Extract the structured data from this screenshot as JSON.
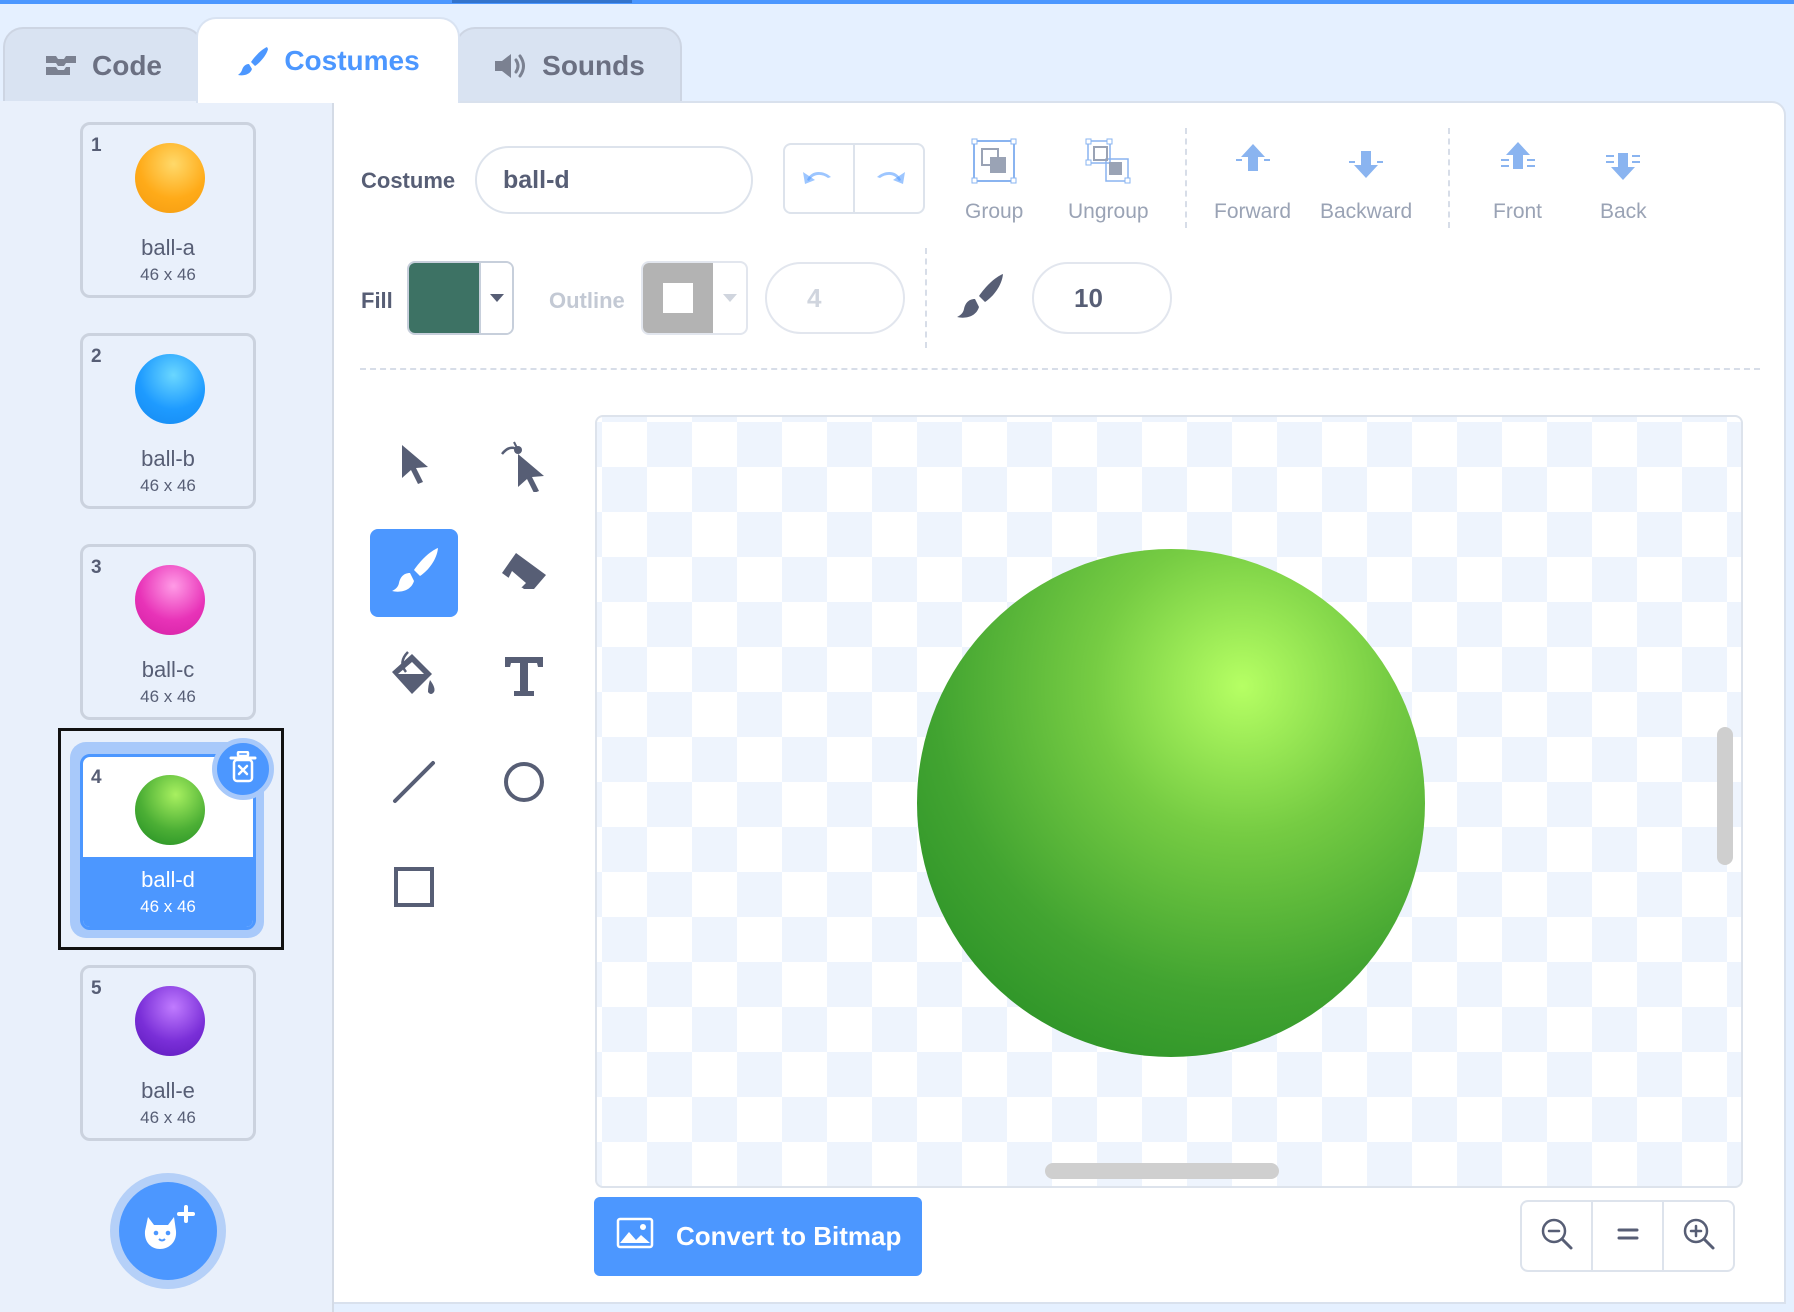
{
  "tabs": [
    {
      "label": "Code",
      "icon": "code-blocks-icon"
    },
    {
      "label": "Costumes",
      "icon": "paintbrush-icon",
      "active": true
    },
    {
      "label": "Sounds",
      "icon": "speaker-icon"
    }
  ],
  "costumes": [
    {
      "number": "1",
      "name": "ball-a",
      "size": "46 x 46",
      "color": "#ffab19"
    },
    {
      "number": "2",
      "name": "ball-b",
      "size": "46 x 46",
      "color": "#1e9bff"
    },
    {
      "number": "3",
      "name": "ball-c",
      "size": "46 x 46",
      "color": "#e833b8"
    },
    {
      "number": "4",
      "name": "ball-d",
      "size": "46 x 46",
      "color": "#3da534",
      "selected": true
    },
    {
      "number": "5",
      "name": "ball-e",
      "size": "46 x 46",
      "color": "#6a22c9"
    }
  ],
  "toolbar": {
    "costume_label": "Costume",
    "costume_name": "ball-d",
    "group_label": "Group",
    "ungroup_label": "Ungroup",
    "forward_label": "Forward",
    "backward_label": "Backward",
    "front_label": "Front",
    "back_label": "Back"
  },
  "properties": {
    "fill_label": "Fill",
    "fill_color": "#3d7264",
    "outline_label": "Outline",
    "outline_width": "4",
    "brush_size": "10"
  },
  "tools": [
    "select",
    "reshape",
    "brush",
    "eraser",
    "fill",
    "text",
    "line",
    "circle",
    "rectangle"
  ],
  "active_tool": "brush",
  "canvas": {
    "shape_color": "#3da534"
  },
  "convert_label": "Convert to Bitmap",
  "zoom": {
    "out": "zoom-out",
    "reset": "=",
    "in": "zoom-in"
  },
  "colors": {
    "accent": "#4c97ff",
    "text": "#575e75"
  }
}
